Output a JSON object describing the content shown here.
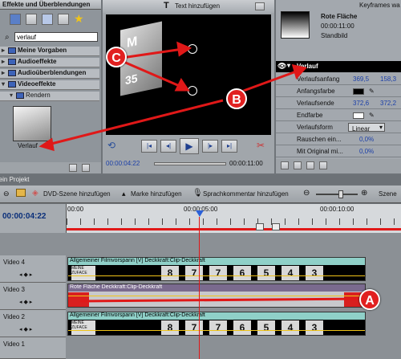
{
  "effects_panel": {
    "title": "Effekte und Überblendungen",
    "search_value": "verlauf",
    "tree": [
      {
        "label": "Meine Vorgaben"
      },
      {
        "label": "Audioeffekte"
      },
      {
        "label": "Audioüberblendungen"
      },
      {
        "label": "Videoeffekte"
      },
      {
        "label": "Rendern"
      }
    ],
    "thumbnail_label": "Verlauf"
  },
  "monitor": {
    "toolbar_text": "Text hinzufügen",
    "timecode_current": "00:00:04:22",
    "timecode_total": "00:00:11:00"
  },
  "keyframes_panel": {
    "header": "Keyframes wa",
    "clip_name": "Rote Fläche",
    "clip_duration": "00:00:11:00",
    "clip_type": "Standbild",
    "effect_name": "Verlauf",
    "properties": [
      {
        "label": "Verlaufsanfang",
        "v1": "369,5",
        "v2": "158,3"
      },
      {
        "label": "Anfangsfarbe",
        "v1": "",
        "v2": ""
      },
      {
        "label": "Verlaufsende",
        "v1": "372,6",
        "v2": "372,2"
      },
      {
        "label": "Endfarbe",
        "v1": "",
        "v2": ""
      },
      {
        "label": "Verlaufsform",
        "v1": "Linear",
        "v2": ""
      },
      {
        "label": "Rauschen ein...",
        "v1": "0,0%",
        "v2": ""
      },
      {
        "label": "Mit Original mi...",
        "v1": "0,0%",
        "v2": ""
      }
    ]
  },
  "project": {
    "title": "Mein Projekt",
    "dvd_button": "DVD-Szene hinzufügen",
    "marker_button": "Marke hinzufügen",
    "narration_button": "Sprachkommentar hinzufügen",
    "scene_button": "Szene",
    "timecode": "00:00:04:22",
    "ruler_labels": [
      "00:00",
      "00:00:05:00",
      "00:00:10:00"
    ]
  },
  "tracks": [
    {
      "name": "Video 4",
      "clip": "Allgemeiner Filmvorspann [V] Deckkraft:Clip-Deckkraft"
    },
    {
      "name": "Video 3",
      "clip": "Rote Fläche  Deckkraft:Clip-Deckkraft"
    },
    {
      "name": "Video 2",
      "clip": "Allgemeiner Filmvorspann [V] Deckkraft:Clip-Deckkraft"
    },
    {
      "name": "Video 1",
      "clip": ""
    }
  ],
  "countdown_digits": [
    "8",
    "7",
    "7",
    "6",
    "5",
    "4",
    "3"
  ],
  "annotations": {
    "a": "A",
    "b": "B",
    "c": "C"
  },
  "colors": {
    "accent_red": "#e12020",
    "timeline_blue": "#0a2f7a"
  }
}
